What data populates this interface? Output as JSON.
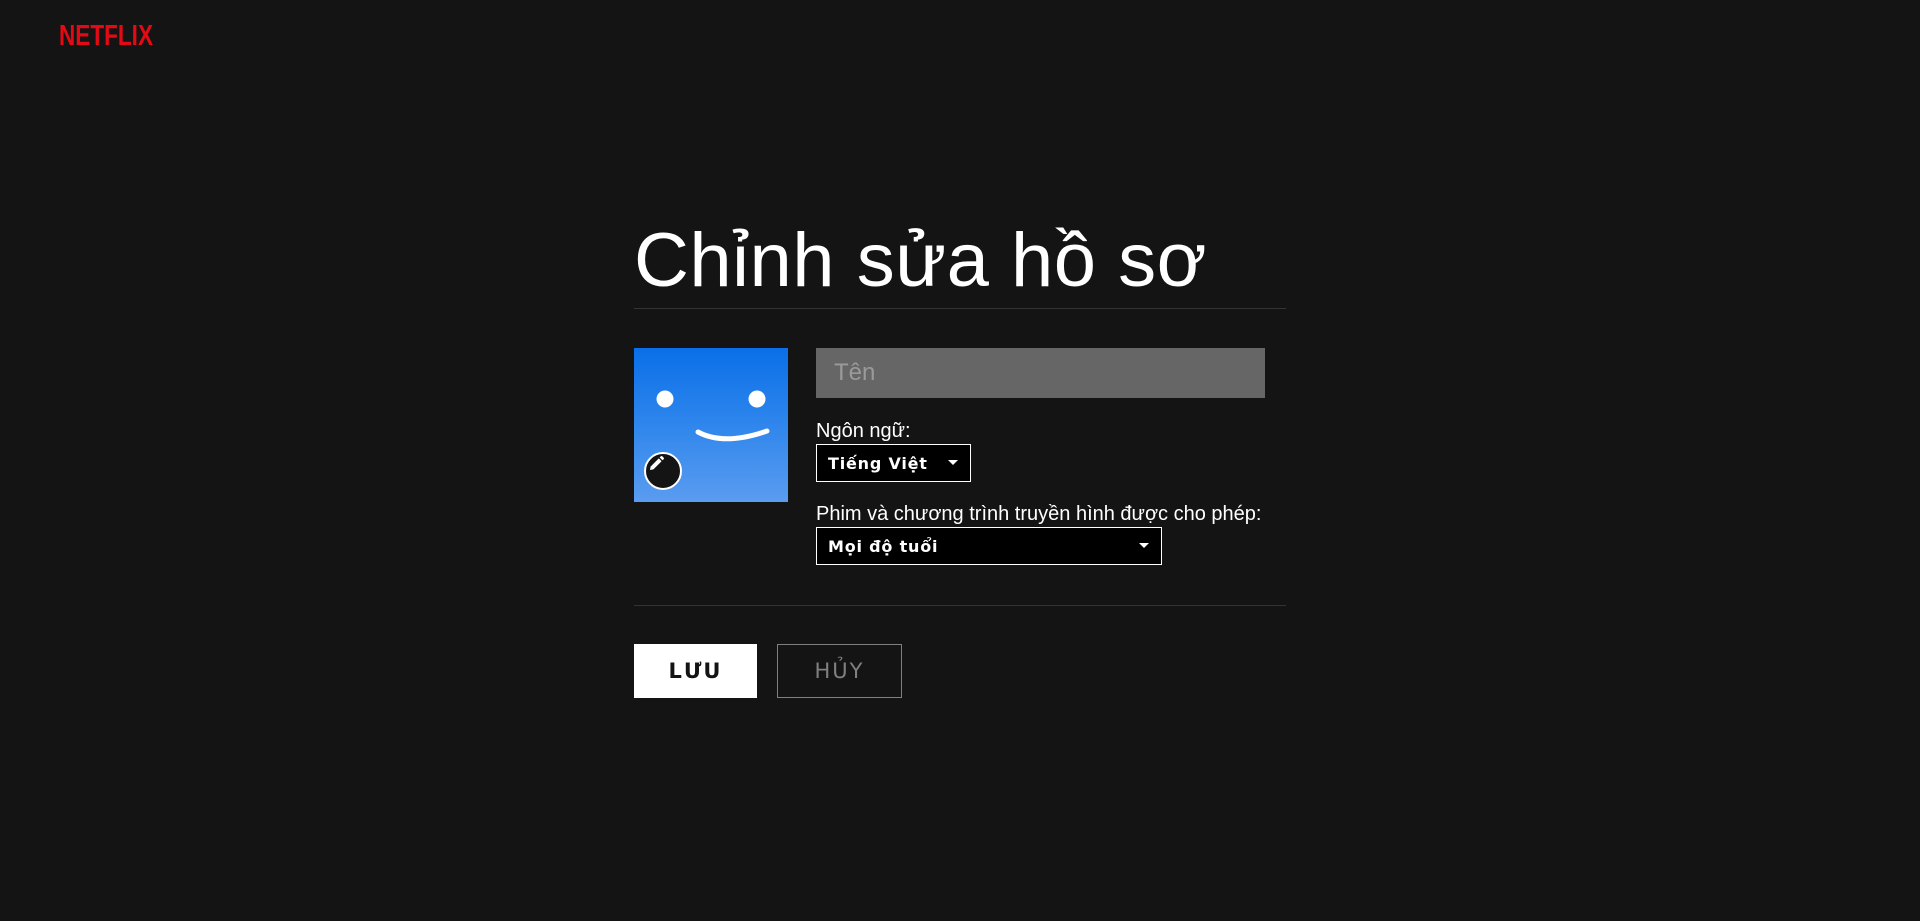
{
  "brand": {
    "logo_text": "NETFLIX",
    "color": "#e50914"
  },
  "editor": {
    "title": "Chỉnh sửa hồ sơ",
    "avatar": {
      "icon": "smiley-face-icon",
      "background": "#1a7ae9",
      "edit_icon": "pencil-icon"
    },
    "name_field": {
      "placeholder": "Tên",
      "value": ""
    },
    "language": {
      "label": "Ngôn ngữ:",
      "selected": "Tiếng Việt"
    },
    "maturity": {
      "label": "Phim và chương trình truyền hình được cho phép:",
      "selected": "Mọi độ tuổi"
    }
  },
  "actions": {
    "save_label": "LƯU",
    "cancel_label": "HỦY"
  }
}
